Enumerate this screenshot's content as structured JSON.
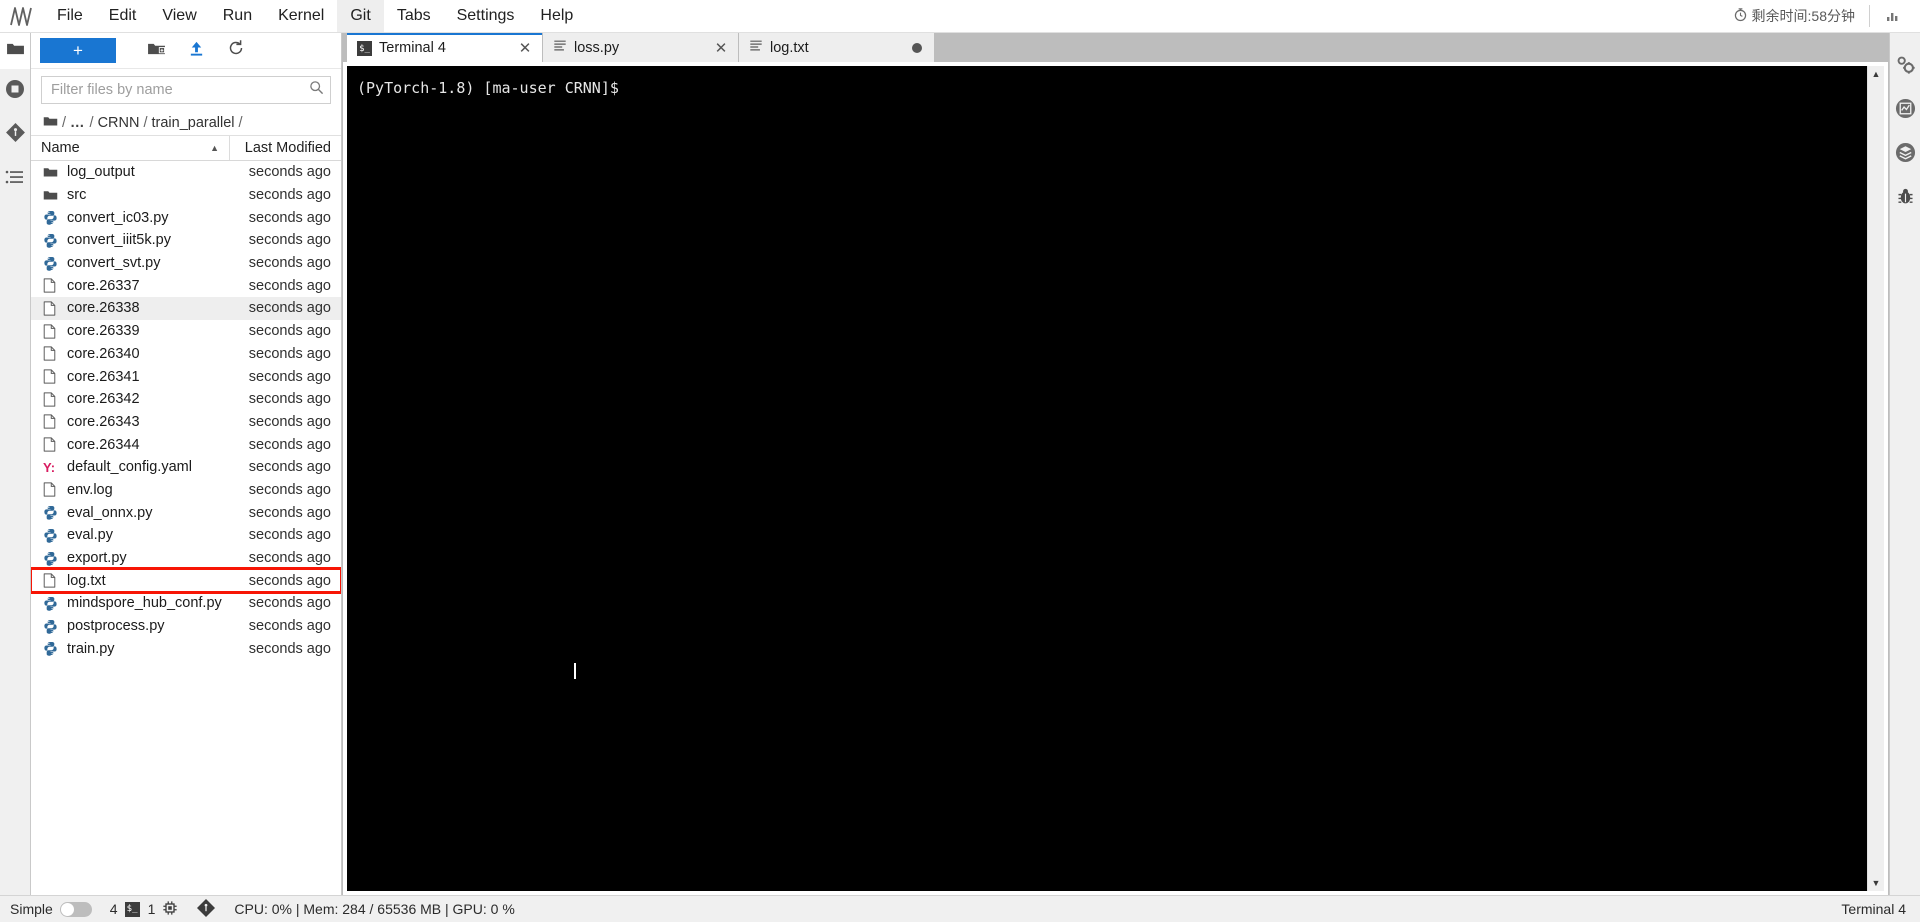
{
  "app": {
    "logo_icon": "jupyterlab-logo-icon",
    "bottom_right_label": "Terminal 4"
  },
  "menubar": {
    "items": [
      {
        "label": "File",
        "active": false
      },
      {
        "label": "Edit",
        "active": false
      },
      {
        "label": "View",
        "active": false
      },
      {
        "label": "Run",
        "active": false
      },
      {
        "label": "Kernel",
        "active": false
      },
      {
        "label": "Git",
        "active": true
      },
      {
        "label": "Tabs",
        "active": false
      },
      {
        "label": "Settings",
        "active": false
      },
      {
        "label": "Help",
        "active": false
      }
    ],
    "timer": {
      "icon": "stopwatch-icon",
      "text": "剩余时间:58分钟"
    },
    "extra_icon": "signal-bars-icon"
  },
  "left_sidebar": {
    "items": [
      {
        "name": "file-browser",
        "icon": "folder-icon",
        "active": true
      },
      {
        "name": "running-sessions",
        "icon": "stop-circle-icon",
        "active": false
      },
      {
        "name": "git-panel",
        "icon": "git-diamond-icon",
        "active": false
      },
      {
        "name": "table-of-contents",
        "icon": "list-icon",
        "active": false
      }
    ]
  },
  "right_sidebar": {
    "items": [
      {
        "name": "property-inspector",
        "icon": "gears-icon"
      },
      {
        "name": "system-monitor",
        "icon": "chart-monitor-icon"
      },
      {
        "name": "extension-manager",
        "icon": "layers-icon"
      },
      {
        "name": "debugger",
        "icon": "bug-icon"
      }
    ]
  },
  "filebrowser": {
    "toolbar": {
      "folder_icon": "folder-icon",
      "new_launcher_label": "+",
      "new_folder_icon": "new-folder-icon",
      "upload_icon": "upload-icon",
      "refresh_icon": "refresh-icon"
    },
    "filter": {
      "placeholder": "Filter files by name",
      "value": "",
      "icon": "search-icon"
    },
    "breadcrumb": {
      "root_icon": "folder-icon",
      "segments": [
        "/",
        "…",
        "/",
        "CRNN",
        "/",
        "train_parallel",
        "/"
      ],
      "text": "/ … / CRNN / train_parallel /"
    },
    "columns": {
      "name": "Name",
      "modified": "Last Modified",
      "sort": "ascending"
    },
    "rows": [
      {
        "name": "log_output",
        "icon": "folder-icon",
        "modified": "seconds ago",
        "selected": false,
        "marked": false
      },
      {
        "name": "src",
        "icon": "folder-icon",
        "modified": "seconds ago",
        "selected": false,
        "marked": false
      },
      {
        "name": "convert_ic03.py",
        "icon": "python-icon",
        "modified": "seconds ago",
        "selected": false,
        "marked": false
      },
      {
        "name": "convert_iiit5k.py",
        "icon": "python-icon",
        "modified": "seconds ago",
        "selected": false,
        "marked": false
      },
      {
        "name": "convert_svt.py",
        "icon": "python-icon",
        "modified": "seconds ago",
        "selected": false,
        "marked": false
      },
      {
        "name": "core.26337",
        "icon": "file-icon",
        "modified": "seconds ago",
        "selected": false,
        "marked": false
      },
      {
        "name": "core.26338",
        "icon": "file-icon",
        "modified": "seconds ago",
        "selected": true,
        "marked": false
      },
      {
        "name": "core.26339",
        "icon": "file-icon",
        "modified": "seconds ago",
        "selected": false,
        "marked": false
      },
      {
        "name": "core.26340",
        "icon": "file-icon",
        "modified": "seconds ago",
        "selected": false,
        "marked": false
      },
      {
        "name": "core.26341",
        "icon": "file-icon",
        "modified": "seconds ago",
        "selected": false,
        "marked": false
      },
      {
        "name": "core.26342",
        "icon": "file-icon",
        "modified": "seconds ago",
        "selected": false,
        "marked": false
      },
      {
        "name": "core.26343",
        "icon": "file-icon",
        "modified": "seconds ago",
        "selected": false,
        "marked": false
      },
      {
        "name": "core.26344",
        "icon": "file-icon",
        "modified": "seconds ago",
        "selected": false,
        "marked": false
      },
      {
        "name": "default_config.yaml",
        "icon": "yaml-icon",
        "modified": "seconds ago",
        "selected": false,
        "marked": false
      },
      {
        "name": "env.log",
        "icon": "file-icon",
        "modified": "seconds ago",
        "selected": false,
        "marked": false
      },
      {
        "name": "eval_onnx.py",
        "icon": "python-icon",
        "modified": "seconds ago",
        "selected": false,
        "marked": false
      },
      {
        "name": "eval.py",
        "icon": "python-icon",
        "modified": "seconds ago",
        "selected": false,
        "marked": false
      },
      {
        "name": "export.py",
        "icon": "python-icon",
        "modified": "seconds ago",
        "selected": false,
        "marked": false
      },
      {
        "name": "log.txt",
        "icon": "file-icon",
        "modified": "seconds ago",
        "selected": false,
        "marked": true
      },
      {
        "name": "mindspore_hub_conf.py",
        "icon": "python-icon",
        "modified": "seconds ago",
        "selected": false,
        "marked": false
      },
      {
        "name": "postprocess.py",
        "icon": "python-icon",
        "modified": "seconds ago",
        "selected": false,
        "marked": false
      },
      {
        "name": "train.py",
        "icon": "python-icon",
        "modified": "seconds ago",
        "selected": false,
        "marked": false
      }
    ]
  },
  "tabs": [
    {
      "label": "Terminal 4",
      "icon": "terminal-icon",
      "active": true,
      "dirty": false,
      "closable": true
    },
    {
      "label": "loss.py",
      "icon": "text-file-icon",
      "active": false,
      "dirty": false,
      "closable": true
    },
    {
      "label": "log.txt",
      "icon": "text-file-icon",
      "active": false,
      "dirty": true,
      "closable": false
    }
  ],
  "terminal": {
    "lines": [
      "(PyTorch-1.8) [ma-user CRNN]$"
    ],
    "background": "#000000",
    "foreground": "#e6e6e6",
    "cursor_visible": true,
    "scroll_up_icon": "triangle-up-icon",
    "scroll_down_icon": "triangle-down-icon"
  },
  "statusbar": {
    "mode_label": "Simple",
    "mode_enabled": false,
    "terminal_count": "4",
    "terminal_icon": "terminal-icon",
    "kernel_count": "1",
    "kernel_icon": "cpu-chip-icon",
    "git_icon": "git-diamond-icon",
    "resources": "CPU: 0% | Mem: 284 / 65536 MB | GPU: 0 %",
    "right_label": "Terminal 4"
  },
  "colors": {
    "accent": "#1976d2",
    "annotation": "#f71505",
    "python_icon": "#306998",
    "yaml_icon": "#d81b60",
    "chrome": "#bdbdbd",
    "panel": "#f0f0f0"
  }
}
